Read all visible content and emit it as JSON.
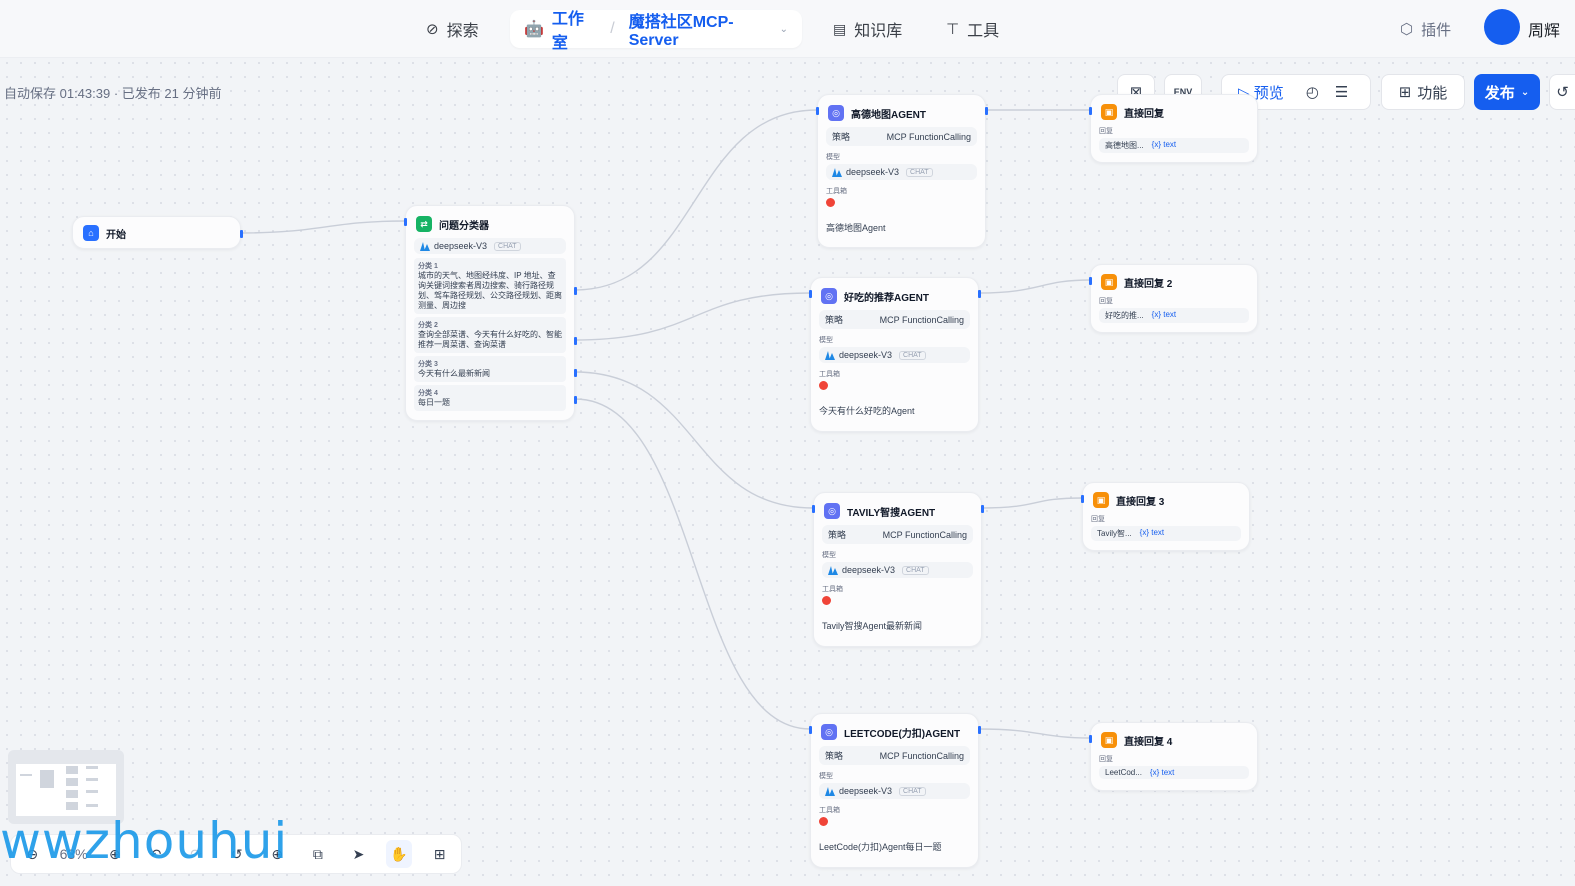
{
  "nav": {
    "explore": "探索",
    "studio": "工作室",
    "app_name": "魔搭社区MCP-Server",
    "knowledge": "知识库",
    "tools": "工具",
    "plugins": "插件",
    "username": "周辉"
  },
  "status": {
    "autosave": "自动保存 01:43:39 · 已发布 21 分钟前"
  },
  "toolbar": {
    "env": "ENV",
    "preview": "预览",
    "features": "功能",
    "publish": "发布"
  },
  "labels": {
    "strategy": "策略",
    "strategy_value": "MCP FunctionCalling",
    "model": "模型",
    "model_name": "deepseek-V3",
    "chat_tag": "CHAT",
    "toolset": "工具箱",
    "reply": "回复",
    "text_var": "text"
  },
  "nodes": {
    "start": {
      "title": "开始"
    },
    "classifier": {
      "title": "问题分类器",
      "categories": [
        {
          "name": "分类 1",
          "text": "城市的天气、地图经纬度、IP 地址、查询关键词搜索者周边搜索、骑行路径规划、驾车路径规划、公交路径规划、距离测量、周边搜"
        },
        {
          "name": "分类 2",
          "text": "查询全部菜谱、今天有什么好吃的、智能推荐一周菜谱、查询菜谱"
        },
        {
          "name": "分类 3",
          "text": "今天有什么最新新闻"
        },
        {
          "name": "分类 4",
          "text": "每日一题"
        }
      ]
    },
    "agent1": {
      "title": "高德地图AGENT",
      "desc": "高德地图Agent"
    },
    "agent2": {
      "title": "好吃的推荐AGENT",
      "desc": "今天有什么好吃的Agent"
    },
    "agent3": {
      "title": "TAVILY智搜AGENT",
      "desc": "Tavily智搜Agent最新新闻"
    },
    "agent4": {
      "title": "LEETCODE(力扣)AGENT",
      "desc": "LeetCode(力扣)Agent每日一题"
    },
    "reply1": {
      "title": "直接回复",
      "source": "高德地图..."
    },
    "reply2": {
      "title": "直接回复 2",
      "source": "好吃的推..."
    },
    "reply3": {
      "title": "直接回复 3",
      "source": "Tavily智..."
    },
    "reply4": {
      "title": "直接回复 4",
      "source": "LeetCod..."
    }
  },
  "bottom": {
    "zoom": "63%"
  },
  "watermark": "wwzhouhui",
  "colors": {
    "accent": "#155eef",
    "start_icon": "#2970ff",
    "classifier_icon": "#16b364",
    "agent_icon": "#6172f3",
    "reply_icon": "#f79009",
    "edge": "#d0d5dd"
  }
}
